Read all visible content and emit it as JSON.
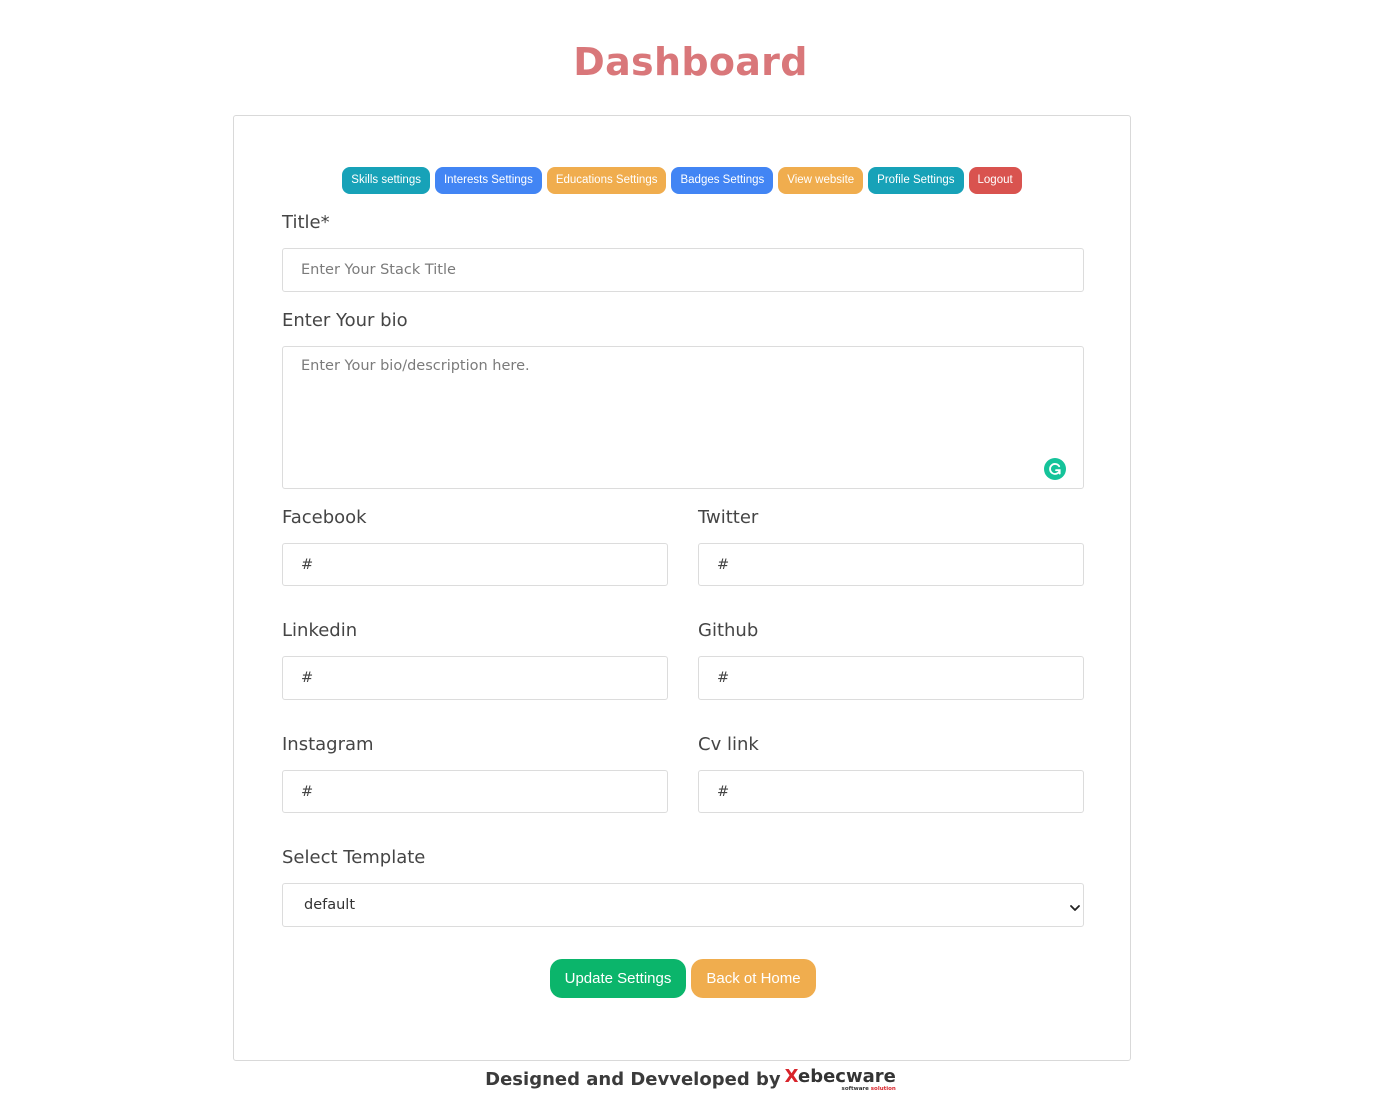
{
  "page": {
    "title": "Dashboard"
  },
  "nav": {
    "buttons": [
      {
        "label": "Skills settings",
        "color": "#17a2b8"
      },
      {
        "label": "Interests Settings",
        "color": "#4285f4"
      },
      {
        "label": "Educations Settings",
        "color": "#f0ad4e"
      },
      {
        "label": "Badges Settings",
        "color": "#4285f4"
      },
      {
        "label": "View website",
        "color": "#f0ad4e"
      },
      {
        "label": "Profile Settings",
        "color": "#17a2b8"
      },
      {
        "label": "Logout",
        "color": "#d9534f"
      }
    ]
  },
  "form": {
    "title": {
      "label": "Title*",
      "placeholder": "Enter Your Stack Title",
      "value": ""
    },
    "bio": {
      "label": "Enter Your bio",
      "placeholder": "Enter Your bio/description here.",
      "value": ""
    },
    "facebook": {
      "label": "Facebook",
      "value": "#"
    },
    "twitter": {
      "label": "Twitter",
      "value": "#"
    },
    "linkedin": {
      "label": "Linkedin",
      "value": "#"
    },
    "github": {
      "label": "Github",
      "value": "#"
    },
    "instagram": {
      "label": "Instagram",
      "value": "#"
    },
    "cv": {
      "label": "Cv link",
      "value": "#"
    },
    "template": {
      "label": "Select Template",
      "selected": "default",
      "options": [
        "default"
      ]
    },
    "update_label": "Update Settings",
    "back_label": "Back ot Home"
  },
  "colors": {
    "title": "#d9777a",
    "update_button": "#0bb56b",
    "back_button": "#f0ad4e",
    "grammarly": "#15c39a"
  },
  "footer": {
    "text": "Designed and Devveloped by",
    "brand_x": "X",
    "brand_rest": "ebecware",
    "brand_sub_a": "software",
    "brand_sub_b": "solution"
  }
}
